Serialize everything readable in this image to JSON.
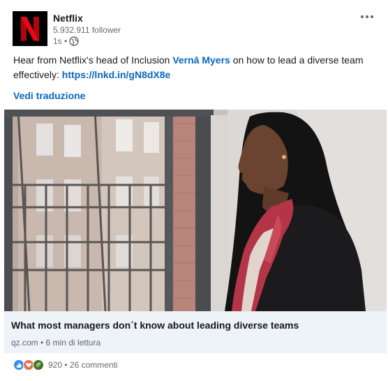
{
  "post": {
    "author": {
      "name": "Netflix",
      "followers": "5.932.911 follower",
      "time": "1s •"
    },
    "text": {
      "before_mention": "Hear from Netflix's head of Inclusion ",
      "mention": "Vernā Myers",
      "after_mention": " on how to lead a diverse team effectively: ",
      "link": "https://lnkd.in/gN8dX8e"
    },
    "translate_label": "Vedi traduzione",
    "article": {
      "title": "What most managers don´t know about leading diverse teams",
      "source": "qz.com • 6 min di lettura"
    },
    "social": {
      "counts": "920 • 26 commenti",
      "reaction_icons": [
        "like-icon",
        "love-icon",
        "insightful-icon"
      ]
    }
  },
  "colors": {
    "link": "#0a66c2",
    "logo_bg": "#000000",
    "logo_red": "#e50914",
    "article_bg": "#eef3f8"
  },
  "icons": {
    "menu": "more-options-icon",
    "visibility": "globe-icon"
  }
}
